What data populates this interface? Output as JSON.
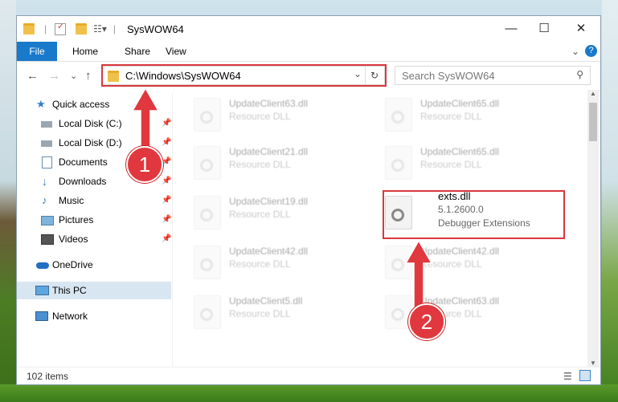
{
  "window": {
    "title": "SysWOW64",
    "minimize_label": "—",
    "maximize_label": "☐",
    "close_label": "✕"
  },
  "ribbon": {
    "file_label": "File",
    "tabs": [
      "Home",
      "Share",
      "View"
    ],
    "collapse_label": "⌄",
    "help_label": "?"
  },
  "address": {
    "path": "C:\\Windows\\SysWOW64",
    "dropdown_label": "⌄",
    "refresh_label": "↻",
    "search_placeholder": "Search SysWOW64",
    "back_label": "←",
    "forward_label": "→",
    "recent_label": "⌄",
    "up_label": "↑"
  },
  "sidebar": {
    "items": [
      {
        "label": "Quick access",
        "icon": "star-icon"
      },
      {
        "label": "Local Disk (C:)",
        "icon": "drive-icon",
        "pinned": true
      },
      {
        "label": "Local Disk (D:)",
        "icon": "drive-icon",
        "pinned": true
      },
      {
        "label": "Documents",
        "icon": "documents-icon",
        "pinned": true
      },
      {
        "label": "Downloads",
        "icon": "downloads-icon",
        "pinned": true
      },
      {
        "label": "Music",
        "icon": "music-icon",
        "pinned": true
      },
      {
        "label": "Pictures",
        "icon": "pictures-icon",
        "pinned": true
      },
      {
        "label": "Videos",
        "icon": "videos-icon",
        "pinned": true
      },
      {
        "label": "OneDrive",
        "icon": "cloud-icon"
      },
      {
        "label": "This PC",
        "icon": "computer-icon",
        "selected": true
      },
      {
        "label": "Network",
        "icon": "network-icon"
      }
    ],
    "pin_glyph": "📌"
  },
  "files": [
    {
      "name": "UpdateClient63.dll",
      "type": "Resource DLL"
    },
    {
      "name": "UpdateClient65.dll",
      "type": "Resource DLL"
    },
    {
      "name": "UpdateClient21.dll",
      "type": "Resource DLL"
    },
    {
      "name": "UpdateClient65.dll",
      "type": "Resource DLL"
    },
    {
      "name": "UpdateClient19.dll",
      "type": "Resource DLL"
    },
    {
      "name": "exts.dll",
      "version": "5.1.2600.0",
      "type": "Debugger Extensions"
    },
    {
      "name": "UpdateClient42.dll",
      "type": "Resource DLL"
    },
    {
      "name": "UpdateClient42.dll",
      "type": "Resource DLL"
    },
    {
      "name": "UpdateClient5.dll",
      "type": "Resource DLL"
    },
    {
      "name": "UpdateClient63.dll",
      "type": "Resource DLL"
    }
  ],
  "status": {
    "item_count": "102 items"
  },
  "annotations": {
    "callout_1": "1",
    "callout_2": "2",
    "accent_color": "#d9373d"
  },
  "colors": {
    "file_tab": "#1979ca",
    "selected_nav": "#d8e6f2"
  }
}
